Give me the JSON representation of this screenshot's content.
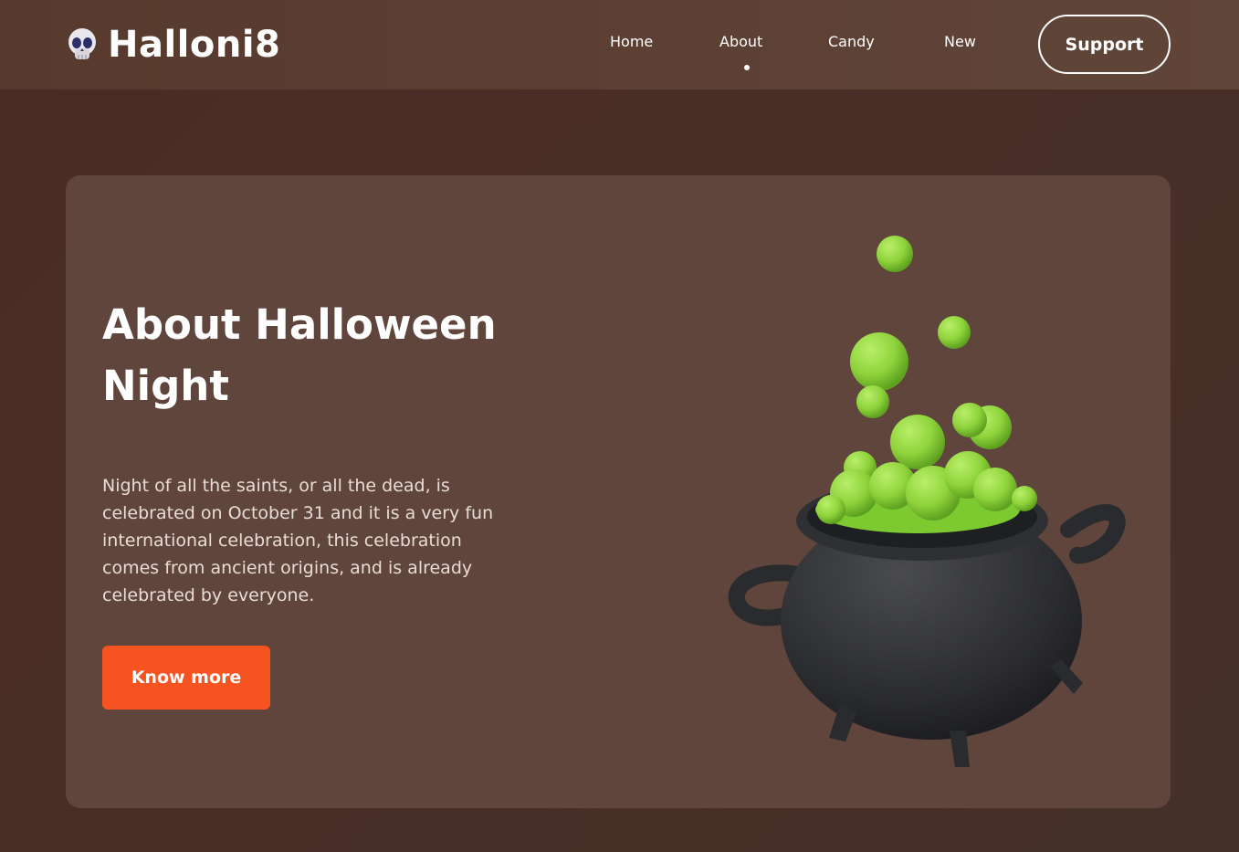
{
  "header": {
    "brand": "Halloni8",
    "logo_icon": "skull-icon",
    "nav": [
      "Home",
      "About",
      "Candy",
      "New"
    ],
    "active_nav": "About",
    "support_label": "Support"
  },
  "hero": {
    "title": "About Halloween Night",
    "description": "Night of all the saints, or all the dead, is celebrated on October 31 and it is a very fun international celebration, this celebration comes from ancient origins, and is already celebrated by everyone.",
    "button_label": "Know more",
    "image_icon": "cauldron-icon"
  },
  "colors": {
    "background": "#4b2c24",
    "header": "#5e4236",
    "card": "#5f453b",
    "accent": "#f55420",
    "bubble": "#8fd33c"
  }
}
